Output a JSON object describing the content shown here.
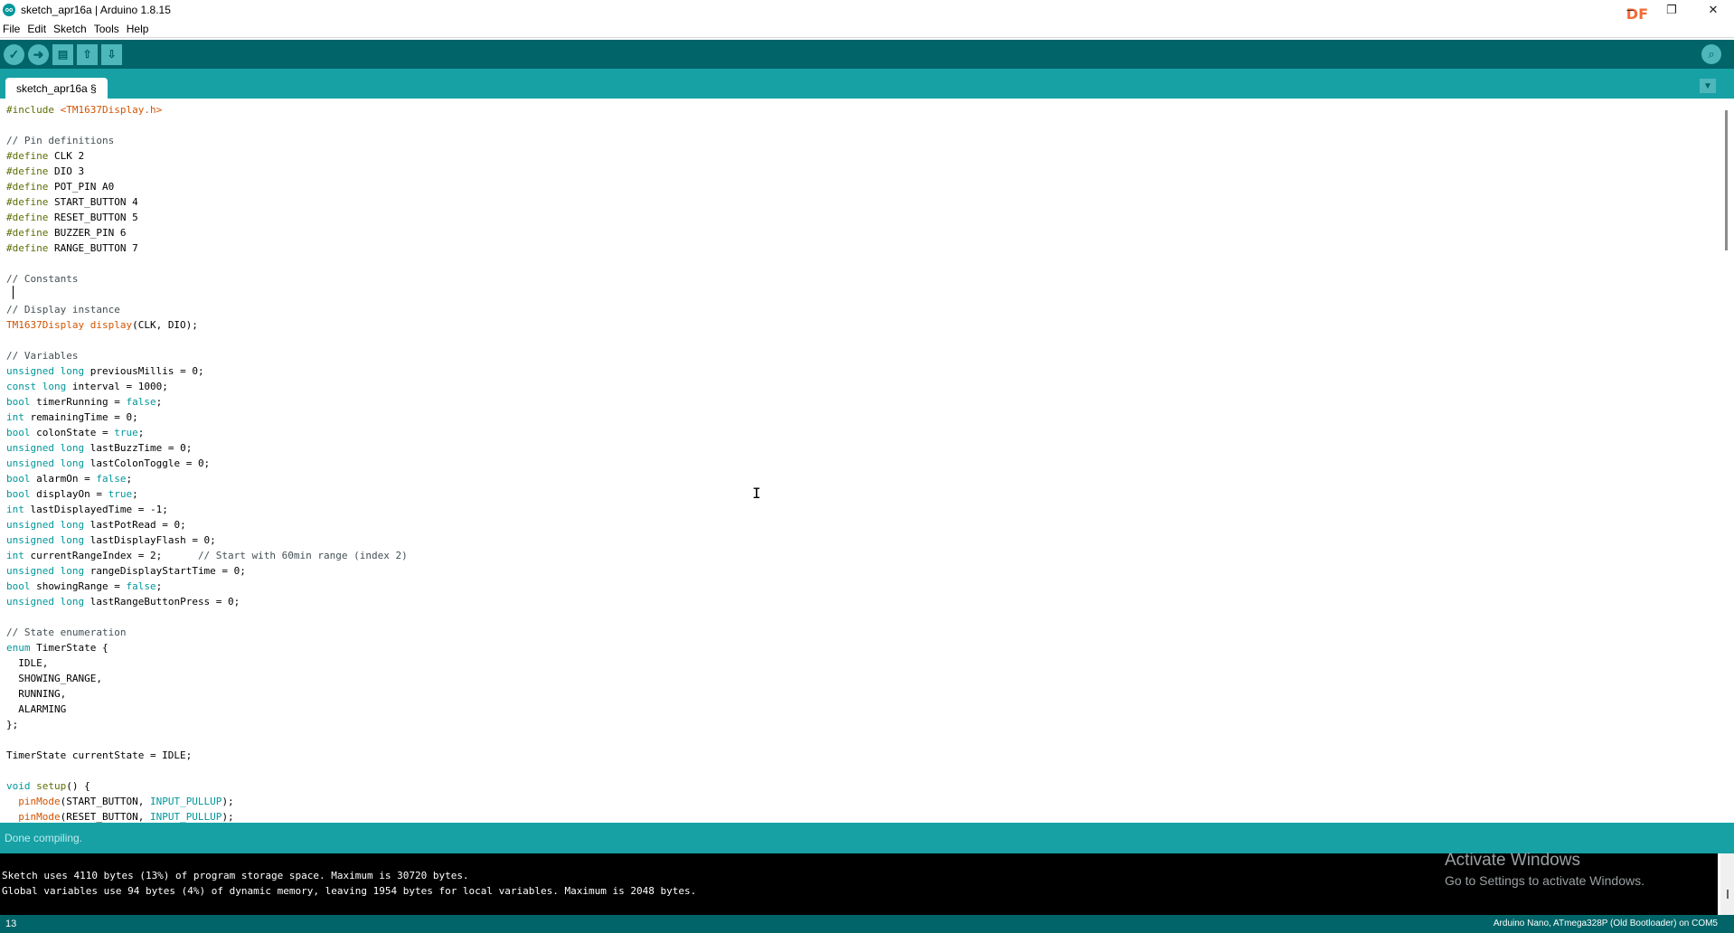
{
  "window": {
    "title": "sketch_apr16a | Arduino 1.8.15",
    "app_icon_text": "oo",
    "controls": {
      "minimize": "–",
      "maximize": "❐",
      "close": "✕"
    },
    "watermark": "DF"
  },
  "menu": {
    "items": [
      "File",
      "Edit",
      "Sketch",
      "Tools",
      "Help"
    ]
  },
  "toolbar": {
    "verify_icon": "✓",
    "upload_icon": "➜",
    "new_icon": "▤",
    "open_icon": "⇧",
    "save_icon": "⇩",
    "serial_monitor_icon": "⌕"
  },
  "tabs": {
    "active": "sketch_apr16a §",
    "menu_icon": "▼"
  },
  "editor": {
    "lines": [
      [
        {
          "t": "#include",
          "c": "kw2"
        },
        {
          "t": " "
        },
        {
          "t": "<TM1637Display.h>",
          "c": "ty"
        }
      ],
      [],
      [
        {
          "t": "// Pin definitions",
          "c": "cm"
        }
      ],
      [
        {
          "t": "#define",
          "c": "kw2"
        },
        {
          "t": " CLK 2"
        }
      ],
      [
        {
          "t": "#define",
          "c": "kw2"
        },
        {
          "t": " DIO 3"
        }
      ],
      [
        {
          "t": "#define",
          "c": "kw2"
        },
        {
          "t": " POT_PIN A0"
        }
      ],
      [
        {
          "t": "#define",
          "c": "kw2"
        },
        {
          "t": " START_BUTTON 4"
        }
      ],
      [
        {
          "t": "#define",
          "c": "kw2"
        },
        {
          "t": " RESET_BUTTON 5"
        }
      ],
      [
        {
          "t": "#define",
          "c": "kw2"
        },
        {
          "t": " BUZZER_PIN 6"
        }
      ],
      [
        {
          "t": "#define",
          "c": "kw2"
        },
        {
          "t": " RANGE_BUTTON 7"
        }
      ],
      [],
      [
        {
          "t": "// Constants",
          "c": "cm"
        }
      ],
      [],
      [
        {
          "t": "// Display instance",
          "c": "cm"
        }
      ],
      [
        {
          "t": "TM1637Display",
          "c": "ty"
        },
        {
          "t": " "
        },
        {
          "t": "display",
          "c": "ty"
        },
        {
          "t": "(CLK, DIO);"
        }
      ],
      [],
      [
        {
          "t": "// Variables",
          "c": "cm"
        }
      ],
      [
        {
          "t": "unsigned",
          "c": "kw"
        },
        {
          "t": " "
        },
        {
          "t": "long",
          "c": "kw"
        },
        {
          "t": " previousMillis = 0;"
        }
      ],
      [
        {
          "t": "const",
          "c": "kw"
        },
        {
          "t": " "
        },
        {
          "t": "long",
          "c": "kw"
        },
        {
          "t": " interval = 1000;"
        }
      ],
      [
        {
          "t": "bool",
          "c": "kw"
        },
        {
          "t": " timerRunning = "
        },
        {
          "t": "false",
          "c": "kw"
        },
        {
          "t": ";"
        }
      ],
      [
        {
          "t": "int",
          "c": "kw"
        },
        {
          "t": " remainingTime = 0;"
        }
      ],
      [
        {
          "t": "bool",
          "c": "kw"
        },
        {
          "t": " colonState = "
        },
        {
          "t": "true",
          "c": "kw"
        },
        {
          "t": ";"
        }
      ],
      [
        {
          "t": "unsigned",
          "c": "kw"
        },
        {
          "t": " "
        },
        {
          "t": "long",
          "c": "kw"
        },
        {
          "t": " lastBuzzTime = 0;"
        }
      ],
      [
        {
          "t": "unsigned",
          "c": "kw"
        },
        {
          "t": " "
        },
        {
          "t": "long",
          "c": "kw"
        },
        {
          "t": " lastColonToggle = 0;"
        }
      ],
      [
        {
          "t": "bool",
          "c": "kw"
        },
        {
          "t": " alarmOn = "
        },
        {
          "t": "false",
          "c": "kw"
        },
        {
          "t": ";"
        }
      ],
      [
        {
          "t": "bool",
          "c": "kw"
        },
        {
          "t": " displayOn = "
        },
        {
          "t": "true",
          "c": "kw"
        },
        {
          "t": ";"
        }
      ],
      [
        {
          "t": "int",
          "c": "kw"
        },
        {
          "t": " lastDisplayedTime = -1;"
        }
      ],
      [
        {
          "t": "unsigned",
          "c": "kw"
        },
        {
          "t": " "
        },
        {
          "t": "long",
          "c": "kw"
        },
        {
          "t": " lastPotRead = 0;"
        }
      ],
      [
        {
          "t": "unsigned",
          "c": "kw"
        },
        {
          "t": " "
        },
        {
          "t": "long",
          "c": "kw"
        },
        {
          "t": " lastDisplayFlash = 0;"
        }
      ],
      [
        {
          "t": "int",
          "c": "kw"
        },
        {
          "t": " currentRangeIndex = 2;      "
        },
        {
          "t": "// Start with 60min range (index 2)",
          "c": "cm"
        }
      ],
      [
        {
          "t": "unsigned",
          "c": "kw"
        },
        {
          "t": " "
        },
        {
          "t": "long",
          "c": "kw"
        },
        {
          "t": " rangeDisplayStartTime = 0;"
        }
      ],
      [
        {
          "t": "bool",
          "c": "kw"
        },
        {
          "t": " showingRange = "
        },
        {
          "t": "false",
          "c": "kw"
        },
        {
          "t": ";"
        }
      ],
      [
        {
          "t": "unsigned",
          "c": "kw"
        },
        {
          "t": " "
        },
        {
          "t": "long",
          "c": "kw"
        },
        {
          "t": " lastRangeButtonPress = 0;"
        }
      ],
      [],
      [
        {
          "t": "// State enumeration",
          "c": "cm"
        }
      ],
      [
        {
          "t": "enum",
          "c": "kw"
        },
        {
          "t": " TimerState {"
        }
      ],
      [
        {
          "t": "  IDLE,"
        }
      ],
      [
        {
          "t": "  SHOWING_RANGE,"
        }
      ],
      [
        {
          "t": "  RUNNING,"
        }
      ],
      [
        {
          "t": "  ALARMING"
        }
      ],
      [
        {
          "t": "};"
        }
      ],
      [],
      [
        {
          "t": "TimerState currentState = IDLE;"
        }
      ],
      [],
      [
        {
          "t": "void",
          "c": "kw"
        },
        {
          "t": " "
        },
        {
          "t": "setup",
          "c": "kw2"
        },
        {
          "t": "() {"
        }
      ],
      [
        {
          "t": "  "
        },
        {
          "t": "pinMode",
          "c": "ty"
        },
        {
          "t": "(START_BUTTON, "
        },
        {
          "t": "INPUT_PULLUP",
          "c": "kw"
        },
        {
          "t": ");"
        }
      ],
      [
        {
          "t": "  "
        },
        {
          "t": "pinMode",
          "c": "ty"
        },
        {
          "t": "(RESET_BUTTON, "
        },
        {
          "t": "INPUT_PULLUP",
          "c": "kw"
        },
        {
          "t": ");"
        }
      ]
    ]
  },
  "status": {
    "message": "Done compiling."
  },
  "console": {
    "lines": [
      "Sketch uses 4110 bytes (13%) of program storage space. Maximum is 30720 bytes.",
      "Global variables use 94 bytes (4%) of dynamic memory, leaving 1954 bytes for local variables. Maximum is 2048 bytes."
    ]
  },
  "activation": {
    "title": "Activate Windows",
    "subtitle": "Go to Settings to activate Windows."
  },
  "footer": {
    "line_number": "13",
    "board": "Arduino Nano, ATmega328P (Old Bootloader) on COM5"
  },
  "colors": {
    "toolbar": "#006468",
    "tabbar": "#17a1a5",
    "button": "#4db7bb",
    "keyword": "#00979c",
    "keyword_alt": "#5e6d03",
    "type": "#d35400",
    "comment": "#434f54"
  }
}
